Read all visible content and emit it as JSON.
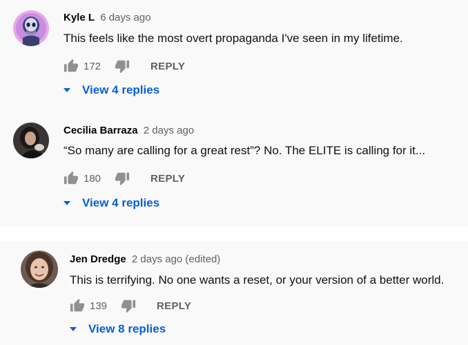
{
  "comments": [
    {
      "author": "Kyle L",
      "time": "6 days ago",
      "text": "This feels like the most overt propaganda I've seen in my lifetime.",
      "likes": "172",
      "reply_label": "REPLY",
      "replies_label": "View 4 replies"
    },
    {
      "author": "Cecilia Barraza",
      "time": "2 days ago",
      "text": "“So many are calling for a great rest”? No. The ELITE is calling for it...",
      "likes": "180",
      "reply_label": "REPLY",
      "replies_label": "View 4 replies"
    },
    {
      "author": "Jen Dredge",
      "time": "2 days ago (edited)",
      "text": "This is terrifying. No one wants a reset, or your version of a better world.",
      "likes": "139",
      "reply_label": "REPLY",
      "replies_label": "View 8 replies"
    }
  ],
  "colors": {
    "link": "#065fd4",
    "muted": "#606060",
    "icon": "#909090",
    "panel": "#f9f9f9"
  }
}
